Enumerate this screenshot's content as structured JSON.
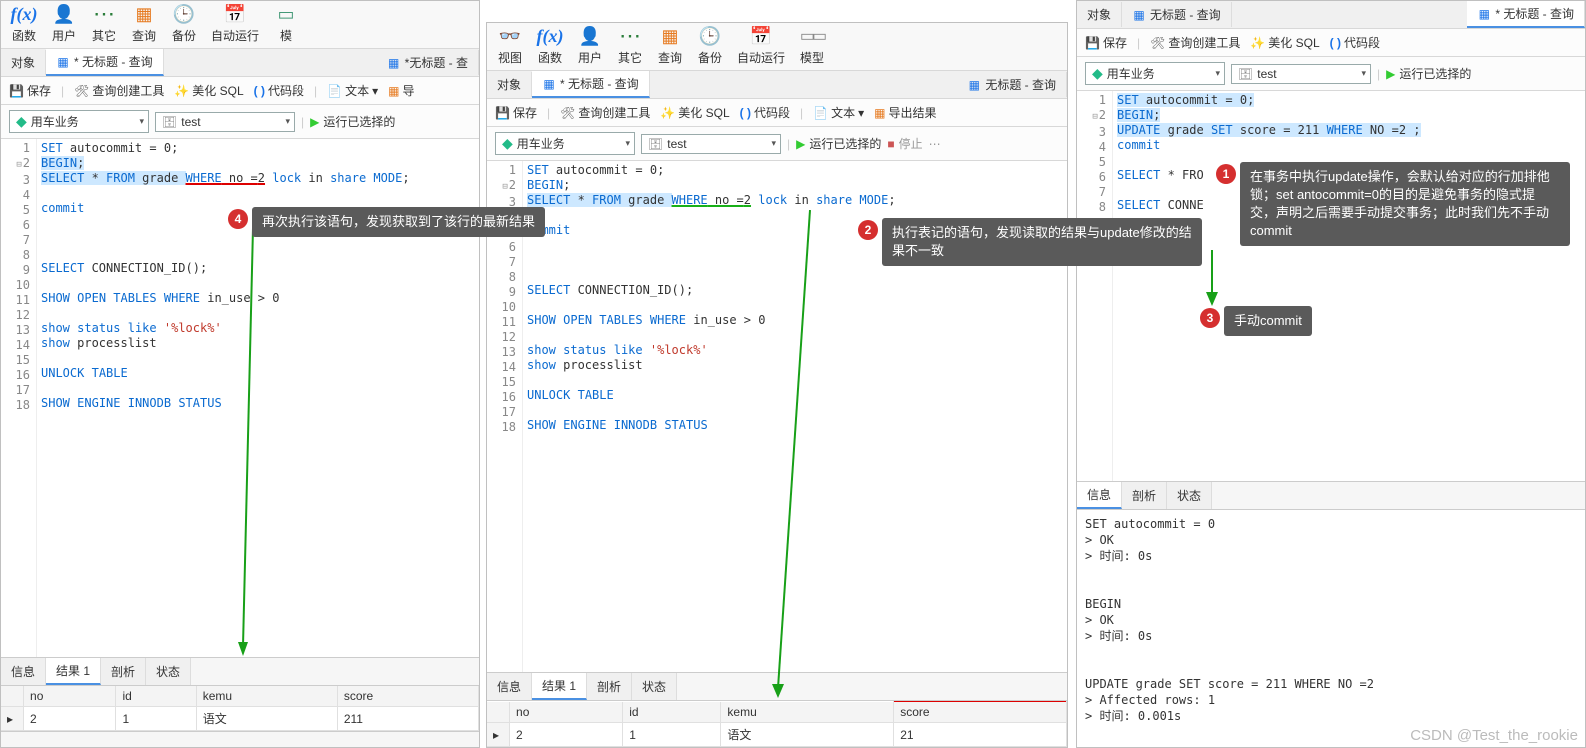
{
  "toolbar": {
    "fn": "函数",
    "user": "用户",
    "other": "其它",
    "query": "查询",
    "backup": "备份",
    "auto": "自动运行",
    "view": "视图",
    "model": "模型",
    "simu": "模"
  },
  "tabs": {
    "object": "对象",
    "untitled_query": "无标题 - 查询",
    "untitled_query2": "* 无标题 - 查询",
    "untitled_que_short": "*无标题 - 查"
  },
  "bar2": {
    "save": "保存",
    "builder": "查询创建工具",
    "beautify": "美化 SQL",
    "snippet": "代码段",
    "text": "文本",
    "export": "导",
    "export2": "导出结果"
  },
  "dd": {
    "conn": "用车业务",
    "db": "test",
    "run": "运行已选择的",
    "stop": "停止"
  },
  "code1": [
    "SET autocommit = 0;",
    "BEGIN;",
    "SELECT * FROM grade WHERE no =2 lock in share MODE;",
    "",
    "commit",
    "",
    "",
    "",
    "SELECT CONNECTION_ID();",
    "",
    "SHOW OPEN TABLES WHERE in_use > 0",
    "",
    "show status like '%lock%'",
    "show processlist",
    "",
    "UNLOCK TABLE",
    "",
    "SHOW ENGINE INNODB STATUS"
  ],
  "code3": [
    "SET autocommit = 0;",
    "BEGIN;",
    "UPDATE grade SET score = 211 WHERE NO =2 ;",
    "commit",
    "",
    "SELECT * FRO",
    "",
    "SELECT CONNE"
  ],
  "res": {
    "info": "信息",
    "result1": "结果 1",
    "profile": "剖析",
    "status": "状态",
    "cols": [
      "no",
      "id",
      "kemu",
      "score"
    ],
    "row1": {
      "no": "2",
      "id": "1",
      "kemu": "语文",
      "score": "211"
    },
    "row2": {
      "no": "2",
      "id": "1",
      "kemu": "语文",
      "score": "21"
    }
  },
  "msg3": "SET autocommit = 0\n> OK\n> 时间: 0s\n\n\nBEGIN\n> OK\n> 时间: 0s\n\n\nUPDATE grade SET score = 211 WHERE NO =2\n> Affected rows: 1\n> 时间: 0.001s",
  "callouts": {
    "c1": "在事务中执行update操作，会默认给对应的行加排他锁；set antocommit=0的目的是避免事务的隐式提交，声明之后需要手动提交事务；此时我们先不手动commit",
    "c2": "执行表记的语句，发现读取的结果与update修改的结果不一致",
    "c3": "手动commit",
    "c4": "再次执行该语句，发现获取到了该行的最新结果"
  },
  "wm": "CSDN @Test_the_rookie"
}
